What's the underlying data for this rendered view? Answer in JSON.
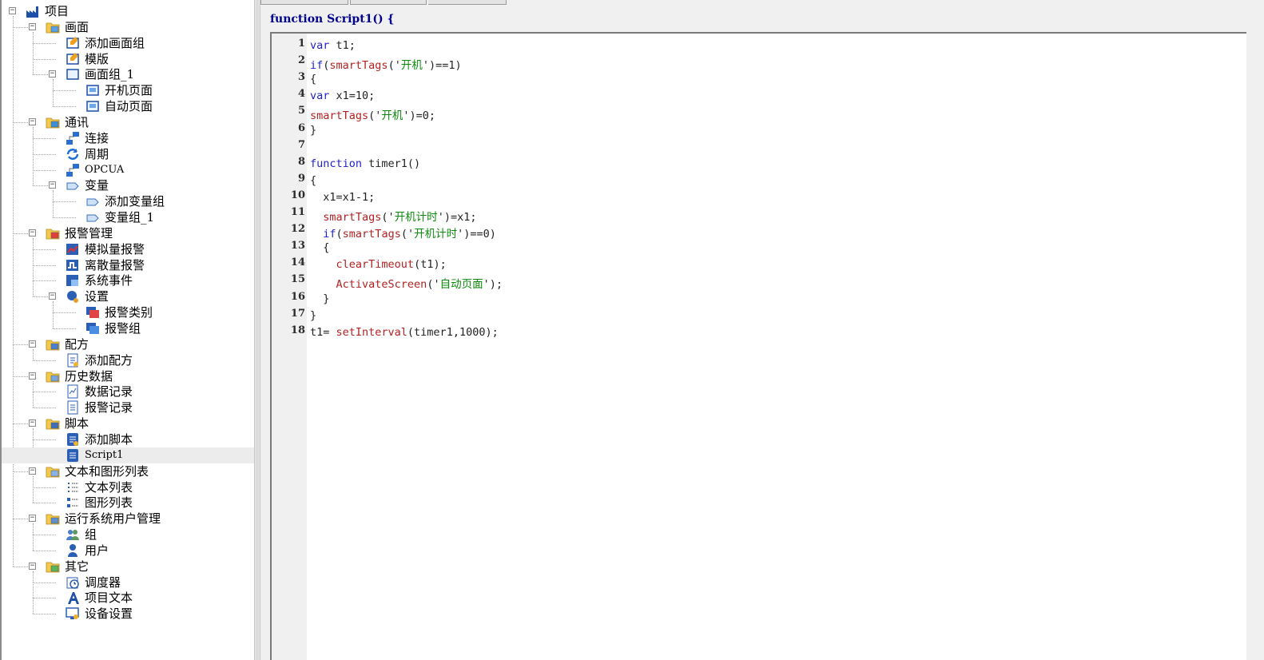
{
  "colors": {
    "keyword": "#1f1fcf",
    "function_call": "#b22222",
    "string": "#0a8a0a",
    "header": "#00008b",
    "selected_row": "#ececec"
  },
  "tree": {
    "items": [
      {
        "label": "项目",
        "depth": 0,
        "icon": "factory-icon",
        "expander": "⊟"
      },
      {
        "label": "画面",
        "depth": 1,
        "icon": "folder-screens-icon",
        "expander": "⊟"
      },
      {
        "label": "添加画面组",
        "depth": 2,
        "icon": "add-screen-group-icon",
        "expander": ""
      },
      {
        "label": "模版",
        "depth": 2,
        "icon": "template-icon",
        "expander": ""
      },
      {
        "label": "画面组_1",
        "depth": 2,
        "icon": "screen-group-icon",
        "expander": "⊟"
      },
      {
        "label": "开机页面",
        "depth": 3,
        "icon": "screen-icon",
        "expander": ""
      },
      {
        "label": "自动页面",
        "depth": 3,
        "icon": "screen-icon",
        "expander": ""
      },
      {
        "label": "通讯",
        "depth": 1,
        "icon": "folder-communication-icon",
        "expander": "⊟"
      },
      {
        "label": "连接",
        "depth": 2,
        "icon": "connection-icon",
        "expander": ""
      },
      {
        "label": "周期",
        "depth": 2,
        "icon": "cycle-icon",
        "expander": ""
      },
      {
        "label": "OPCUA",
        "depth": 2,
        "icon": "opcua-icon",
        "expander": ""
      },
      {
        "label": "变量",
        "depth": 2,
        "icon": "tags-icon",
        "expander": "⊟"
      },
      {
        "label": "添加变量组",
        "depth": 3,
        "icon": "add-tag-group-icon",
        "expander": ""
      },
      {
        "label": "变量组_1",
        "depth": 3,
        "icon": "tag-group-icon",
        "expander": ""
      },
      {
        "label": "报警管理",
        "depth": 1,
        "icon": "folder-alarm-icon",
        "expander": "⊟"
      },
      {
        "label": "模拟量报警",
        "depth": 2,
        "icon": "analog-alarm-icon",
        "expander": ""
      },
      {
        "label": "离散量报警",
        "depth": 2,
        "icon": "discrete-alarm-icon",
        "expander": ""
      },
      {
        "label": "系统事件",
        "depth": 2,
        "icon": "system-event-icon",
        "expander": ""
      },
      {
        "label": "设置",
        "depth": 2,
        "icon": "alarm-settings-icon",
        "expander": "⊟"
      },
      {
        "label": "报警类别",
        "depth": 3,
        "icon": "alarm-class-icon",
        "expander": ""
      },
      {
        "label": "报警组",
        "depth": 3,
        "icon": "alarm-group-icon",
        "expander": ""
      },
      {
        "label": "配方",
        "depth": 1,
        "icon": "folder-recipe-icon",
        "expander": "⊟"
      },
      {
        "label": "添加配方",
        "depth": 2,
        "icon": "add-recipe-icon",
        "expander": ""
      },
      {
        "label": "历史数据",
        "depth": 1,
        "icon": "folder-history-icon",
        "expander": "⊟"
      },
      {
        "label": "数据记录",
        "depth": 2,
        "icon": "data-log-icon",
        "expander": ""
      },
      {
        "label": "报警记录",
        "depth": 2,
        "icon": "alarm-log-icon",
        "expander": ""
      },
      {
        "label": "脚本",
        "depth": 1,
        "icon": "folder-script-icon",
        "expander": "⊟"
      },
      {
        "label": "添加脚本",
        "depth": 2,
        "icon": "add-script-icon",
        "expander": ""
      },
      {
        "label": "Script1",
        "depth": 2,
        "icon": "script-icon",
        "expander": "",
        "selected": true
      },
      {
        "label": "文本和图形列表",
        "depth": 1,
        "icon": "folder-lists-icon",
        "expander": "⊟"
      },
      {
        "label": "文本列表",
        "depth": 2,
        "icon": "text-list-icon",
        "expander": ""
      },
      {
        "label": "图形列表",
        "depth": 2,
        "icon": "graphic-list-icon",
        "expander": ""
      },
      {
        "label": "运行系统用户管理",
        "depth": 1,
        "icon": "folder-user-admin-icon",
        "expander": "⊟"
      },
      {
        "label": "组",
        "depth": 2,
        "icon": "user-group-icon",
        "expander": ""
      },
      {
        "label": "用户",
        "depth": 2,
        "icon": "user-icon",
        "expander": ""
      },
      {
        "label": "其它",
        "depth": 1,
        "icon": "folder-other-icon",
        "expander": "⊟"
      },
      {
        "label": "调度器",
        "depth": 2,
        "icon": "scheduler-icon",
        "expander": ""
      },
      {
        "label": "项目文本",
        "depth": 2,
        "icon": "project-text-icon",
        "expander": ""
      },
      {
        "label": "设备设置",
        "depth": 2,
        "icon": "device-settings-icon",
        "expander": ""
      }
    ]
  },
  "editor": {
    "header_kw": "function",
    "header_name": "Script1()",
    "header_brace": "{",
    "lines": [
      {
        "num": "1",
        "tokens": [
          [
            "kw",
            "var"
          ],
          [
            "op",
            " t1;"
          ]
        ]
      },
      {
        "num": "2",
        "tokens": [
          [
            "kw",
            "if"
          ],
          [
            "op",
            "("
          ],
          [
            "fn",
            "smartTags"
          ],
          [
            "op",
            "('"
          ],
          [
            "str",
            "开机"
          ],
          [
            "op",
            "')==1)"
          ]
        ]
      },
      {
        "num": "3",
        "tokens": [
          [
            "op",
            "{"
          ]
        ]
      },
      {
        "num": "4",
        "tokens": [
          [
            "kw",
            "var"
          ],
          [
            "op",
            " x1=10;"
          ]
        ]
      },
      {
        "num": "5",
        "tokens": [
          [
            "fn",
            "smartTags"
          ],
          [
            "op",
            "('"
          ],
          [
            "str",
            "开机"
          ],
          [
            "op",
            "')=0;"
          ]
        ]
      },
      {
        "num": "6",
        "tokens": [
          [
            "op",
            "}"
          ]
        ]
      },
      {
        "num": "7",
        "tokens": []
      },
      {
        "num": "8",
        "tokens": [
          [
            "kw",
            "function"
          ],
          [
            "op",
            " timer1()"
          ]
        ]
      },
      {
        "num": "9",
        "tokens": [
          [
            "op",
            "{"
          ]
        ]
      },
      {
        "num": "10",
        "tokens": [
          [
            "op",
            "  x1=x1-1;"
          ]
        ]
      },
      {
        "num": "11",
        "tokens": [
          [
            "op",
            "  "
          ],
          [
            "fn",
            "smartTags"
          ],
          [
            "op",
            "('"
          ],
          [
            "str",
            "开机计时"
          ],
          [
            "op",
            "')=x1;"
          ]
        ]
      },
      {
        "num": "12",
        "tokens": [
          [
            "op",
            "  "
          ],
          [
            "kw",
            "if"
          ],
          [
            "op",
            "("
          ],
          [
            "fn",
            "smartTags"
          ],
          [
            "op",
            "('"
          ],
          [
            "str",
            "开机计时"
          ],
          [
            "op",
            "')==0)"
          ]
        ]
      },
      {
        "num": "13",
        "tokens": [
          [
            "op",
            "  {"
          ]
        ]
      },
      {
        "num": "14",
        "tokens": [
          [
            "op",
            "    "
          ],
          [
            "fn",
            "clearTimeout"
          ],
          [
            "op",
            "(t1);"
          ]
        ]
      },
      {
        "num": "15",
        "tokens": [
          [
            "op",
            "    "
          ],
          [
            "fn",
            "ActivateScreen"
          ],
          [
            "op",
            "('"
          ],
          [
            "str",
            "自动页面"
          ],
          [
            "op",
            "');"
          ]
        ]
      },
      {
        "num": "16",
        "tokens": [
          [
            "op",
            "  }"
          ]
        ]
      },
      {
        "num": "17",
        "tokens": [
          [
            "op",
            "}"
          ]
        ]
      },
      {
        "num": "18",
        "tokens": [
          [
            "op",
            "t1= "
          ],
          [
            "fn",
            "setInterval"
          ],
          [
            "op",
            "(timer1,1000);"
          ]
        ]
      }
    ]
  }
}
